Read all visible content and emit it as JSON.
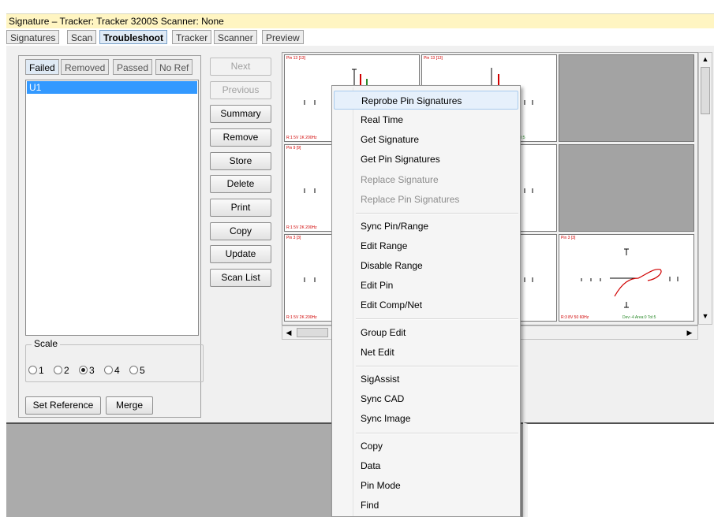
{
  "window": {
    "title": "Signature – Tracker: Tracker 3200S  Scanner: None"
  },
  "main_tabs": [
    "Signatures",
    "Scan",
    "Troubleshoot",
    "Tracker",
    "Scanner",
    "Preview"
  ],
  "sub_tabs": [
    "Failed",
    "Removed",
    "Passed",
    "No Ref"
  ],
  "list_items": [
    "U1"
  ],
  "buttons": {
    "next": "Next",
    "previous": "Previous",
    "summary": "Summary",
    "remove": "Remove",
    "store": "Store",
    "delete": "Delete",
    "print": "Print",
    "copy": "Copy",
    "update": "Update",
    "scan_list": "Scan List",
    "set_reference": "Set Reference",
    "merge": "Merge"
  },
  "scale": {
    "label": "Scale",
    "options": [
      "1",
      "2",
      "3",
      "4",
      "5"
    ],
    "selected": "3"
  },
  "grid": {
    "cells": [
      {
        "pin": "Pin 13 [13]",
        "range": "R:1 5V 1K 200Hz",
        "tol": ""
      },
      {
        "pin": "Pin 13 [13]",
        "range": "",
        "tol": "Tol:5"
      },
      {
        "pin": "Pin 9 [9]",
        "range": "",
        "tol": ""
      },
      {
        "pin": "Pin 3 [3]",
        "range": "R:1 5V 2K 200Hz",
        "tol": ""
      },
      {
        "pin": "Pin 3 [3]",
        "range": "R:1 5V 2K 200Hz",
        "tol": ""
      },
      {
        "pin": "Pin 3 [3]",
        "range": "R:3 8V 50 60Hz",
        "tol": "Dev:-4 Area:0 Tol:5"
      }
    ]
  },
  "context_menu": {
    "groups": [
      [
        {
          "label": "Reprobe Pin Signatures",
          "enabled": true,
          "highlighted": true
        },
        {
          "label": "Real Time",
          "enabled": true
        },
        {
          "label": "Get Signature",
          "enabled": true
        },
        {
          "label": "Get Pin Signatures",
          "enabled": true
        },
        {
          "label": "Replace Signature",
          "enabled": false
        },
        {
          "label": "Replace Pin Signatures",
          "enabled": false
        }
      ],
      [
        {
          "label": "Sync Pin/Range",
          "enabled": true
        },
        {
          "label": "Edit Range",
          "enabled": true
        },
        {
          "label": "Disable Range",
          "enabled": true
        },
        {
          "label": "Edit Pin",
          "enabled": true
        },
        {
          "label": "Edit Comp/Net",
          "enabled": true
        }
      ],
      [
        {
          "label": "Group Edit",
          "enabled": true
        },
        {
          "label": "Net Edit",
          "enabled": true
        }
      ],
      [
        {
          "label": "SigAssist",
          "enabled": true
        },
        {
          "label": "Sync CAD",
          "enabled": true
        },
        {
          "label": "Sync Image",
          "enabled": true
        }
      ],
      [
        {
          "label": "Copy",
          "enabled": true
        },
        {
          "label": "Data",
          "enabled": true
        },
        {
          "label": "Pin Mode",
          "enabled": true
        },
        {
          "label": "Find",
          "enabled": true
        }
      ]
    ]
  },
  "icons": {
    "scroll_up": "up-arrow-icon",
    "scroll_down": "down-arrow-icon",
    "scroll_left": "left-arrow-icon",
    "scroll_right": "right-arrow-icon"
  },
  "colors": {
    "title_bg": "#fff5c2",
    "selection": "#3399ff",
    "menu_highlight": "#e6f0fb",
    "pin_label": "#d00000",
    "tol_label": "#2a8a2a"
  }
}
